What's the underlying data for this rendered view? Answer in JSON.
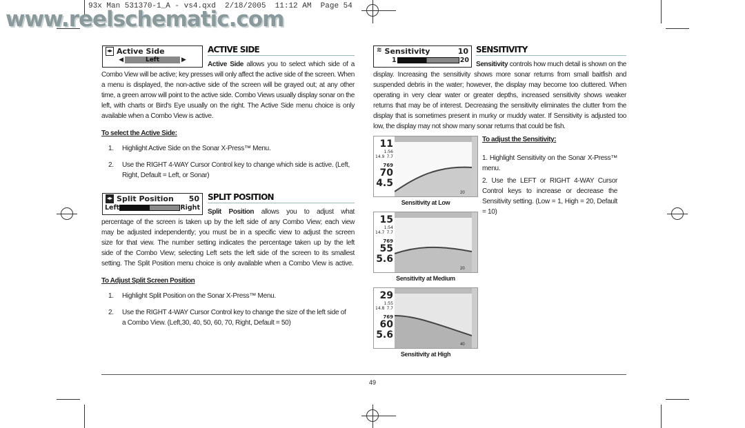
{
  "print_header": "93x Man 531370-1_A - vs4.qxd  2/18/2005  11:12 AM  Page 54",
  "watermark": "www.reelschematic.com",
  "active_side": {
    "menu": {
      "icon": "split-arrows-icon",
      "title": "Active Side",
      "value": "Left"
    },
    "heading": "ACTIVE SIDE",
    "lead": "Active Side",
    "body": " allows you to select which side of a Combo View will be active; key presses will only affect the active side of the screen. When a menu is displayed, the non-active side of the screen will be grayed out; at any other time, a green arrow will point to the active side. Combo Views usually display sonar on the left, with charts or Bird's Eye usually on the right. The Active Side menu choice is only available when a Combo View is active.",
    "steps_title": "To select the Active Side:",
    "steps": [
      {
        "n": "1.",
        "text": "Highlight Active Side on the Sonar X-Press™ Menu."
      },
      {
        "n": "2.",
        "text": "Use the RIGHT 4-WAY Cursor Control key to change which side is active. (Left, Right, Default = Left, or Sonar)"
      }
    ]
  },
  "split_position": {
    "menu": {
      "icon": "split-icon",
      "title": "Split Position",
      "value": "50",
      "left": "Left",
      "right": "Right",
      "level_percent": 50
    },
    "heading": "SPLIT POSITION",
    "lead": "Split Position",
    "body": " allows you to adjust what percentage of the screen is taken up by the left side of any Combo View; each view may be adjusted independently; you must be in a specific view to adjust the screen size for that view. The number setting indicates the percentage taken up by the left side of the Combo View; selecting Left sets the left side of the screen to its smallest setting. The Split Position menu choice is only available when a Combo View is active.",
    "steps_title": "To Adjust Split Screen Position",
    "steps": [
      {
        "n": "1.",
        "text": "Highlight Split Position on the Sonar X-Press™ Menu."
      },
      {
        "n": "2.",
        "text": "Use the RIGHT 4-WAY Cursor Control key to change the size of the left side of a Combo View. (Left,30, 40, 50, 60, 70, Right, Default = 50)"
      }
    ]
  },
  "sensitivity": {
    "menu": {
      "icon": "sensitivity-icon",
      "title": "Sensitivity",
      "value": "10",
      "min": "1",
      "max": "20",
      "level": 10
    },
    "heading": "SENSITIVITY",
    "lead": "Sensitivity",
    "body": " controls how much detail is shown on the display. Increasing the sensitivity shows more sonar returns from small baitfish and suspended debris in the water; however, the display may become too cluttered. When operating in very clear water or greater depths, increased sensitivity shows weaker returns that may be of interest. Decreasing the sensitivity eliminates the clutter from the display that is sometimes present in murky or muddy water. If Sensitivity is adjusted too low, the display may not show many sonar returns that could be fish.",
    "steps_title": "To adjust the Sensitivity:",
    "steps": [
      {
        "n": "1.",
        "text": "Highlight Sensitivity on the Sonar X-Press™ menu."
      },
      {
        "n": "2.",
        "text": "Use the LEFT or RIGHT 4-WAY Cursor Control keys to increase or decrease the Sensitivity setting. (Low = 1, High = 20, Default = 10)"
      }
    ],
    "images": [
      {
        "caption": "Sensitivity at Low",
        "depth": "11",
        "time": "1:56",
        "temp": "14.9",
        "speed": "7.7",
        "voltage": "769",
        "depth2": "70",
        "speed2": "4.5",
        "scale_max": "20"
      },
      {
        "caption": "Sensitivity at Medium",
        "depth": "15",
        "time": "1:54",
        "temp": "14.7",
        "speed": "7.7",
        "voltage": "769",
        "depth2": "55",
        "speed2": "5.6",
        "scale_max": "20"
      },
      {
        "caption": "Sensitivity at High",
        "depth": "29",
        "time": "1:55",
        "temp": "14.8",
        "speed": "7.7",
        "voltage": "769",
        "depth2": "60",
        "speed2": "5.6",
        "scale_max": "40"
      }
    ]
  },
  "page_number": "49"
}
